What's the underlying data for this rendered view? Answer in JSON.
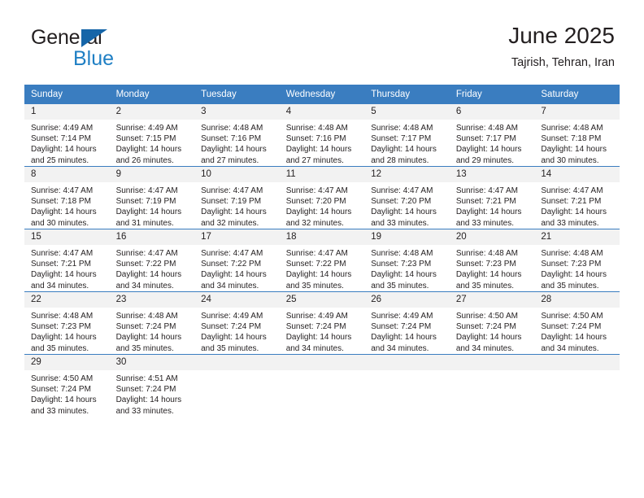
{
  "brand": {
    "name_top": "General",
    "name_bottom": "Blue",
    "accent_color": "#1f7fc4",
    "triangle_color": "#1565a8"
  },
  "header": {
    "title": "June 2025",
    "subtitle": "Tajrish, Tehran, Iran"
  },
  "calendar": {
    "header_bg": "#3a7dc0",
    "daynum_bg": "#f2f2f2",
    "weekdays": [
      "Sunday",
      "Monday",
      "Tuesday",
      "Wednesday",
      "Thursday",
      "Friday",
      "Saturday"
    ],
    "weeks": [
      [
        {
          "day": "1",
          "sunrise": "Sunrise: 4:49 AM",
          "sunset": "Sunset: 7:14 PM",
          "daylight1": "Daylight: 14 hours",
          "daylight2": "and 25 minutes."
        },
        {
          "day": "2",
          "sunrise": "Sunrise: 4:49 AM",
          "sunset": "Sunset: 7:15 PM",
          "daylight1": "Daylight: 14 hours",
          "daylight2": "and 26 minutes."
        },
        {
          "day": "3",
          "sunrise": "Sunrise: 4:48 AM",
          "sunset": "Sunset: 7:16 PM",
          "daylight1": "Daylight: 14 hours",
          "daylight2": "and 27 minutes."
        },
        {
          "day": "4",
          "sunrise": "Sunrise: 4:48 AM",
          "sunset": "Sunset: 7:16 PM",
          "daylight1": "Daylight: 14 hours",
          "daylight2": "and 27 minutes."
        },
        {
          "day": "5",
          "sunrise": "Sunrise: 4:48 AM",
          "sunset": "Sunset: 7:17 PM",
          "daylight1": "Daylight: 14 hours",
          "daylight2": "and 28 minutes."
        },
        {
          "day": "6",
          "sunrise": "Sunrise: 4:48 AM",
          "sunset": "Sunset: 7:17 PM",
          "daylight1": "Daylight: 14 hours",
          "daylight2": "and 29 minutes."
        },
        {
          "day": "7",
          "sunrise": "Sunrise: 4:48 AM",
          "sunset": "Sunset: 7:18 PM",
          "daylight1": "Daylight: 14 hours",
          "daylight2": "and 30 minutes."
        }
      ],
      [
        {
          "day": "8",
          "sunrise": "Sunrise: 4:47 AM",
          "sunset": "Sunset: 7:18 PM",
          "daylight1": "Daylight: 14 hours",
          "daylight2": "and 30 minutes."
        },
        {
          "day": "9",
          "sunrise": "Sunrise: 4:47 AM",
          "sunset": "Sunset: 7:19 PM",
          "daylight1": "Daylight: 14 hours",
          "daylight2": "and 31 minutes."
        },
        {
          "day": "10",
          "sunrise": "Sunrise: 4:47 AM",
          "sunset": "Sunset: 7:19 PM",
          "daylight1": "Daylight: 14 hours",
          "daylight2": "and 32 minutes."
        },
        {
          "day": "11",
          "sunrise": "Sunrise: 4:47 AM",
          "sunset": "Sunset: 7:20 PM",
          "daylight1": "Daylight: 14 hours",
          "daylight2": "and 32 minutes."
        },
        {
          "day": "12",
          "sunrise": "Sunrise: 4:47 AM",
          "sunset": "Sunset: 7:20 PM",
          "daylight1": "Daylight: 14 hours",
          "daylight2": "and 33 minutes."
        },
        {
          "day": "13",
          "sunrise": "Sunrise: 4:47 AM",
          "sunset": "Sunset: 7:21 PM",
          "daylight1": "Daylight: 14 hours",
          "daylight2": "and 33 minutes."
        },
        {
          "day": "14",
          "sunrise": "Sunrise: 4:47 AM",
          "sunset": "Sunset: 7:21 PM",
          "daylight1": "Daylight: 14 hours",
          "daylight2": "and 33 minutes."
        }
      ],
      [
        {
          "day": "15",
          "sunrise": "Sunrise: 4:47 AM",
          "sunset": "Sunset: 7:21 PM",
          "daylight1": "Daylight: 14 hours",
          "daylight2": "and 34 minutes."
        },
        {
          "day": "16",
          "sunrise": "Sunrise: 4:47 AM",
          "sunset": "Sunset: 7:22 PM",
          "daylight1": "Daylight: 14 hours",
          "daylight2": "and 34 minutes."
        },
        {
          "day": "17",
          "sunrise": "Sunrise: 4:47 AM",
          "sunset": "Sunset: 7:22 PM",
          "daylight1": "Daylight: 14 hours",
          "daylight2": "and 34 minutes."
        },
        {
          "day": "18",
          "sunrise": "Sunrise: 4:47 AM",
          "sunset": "Sunset: 7:22 PM",
          "daylight1": "Daylight: 14 hours",
          "daylight2": "and 35 minutes."
        },
        {
          "day": "19",
          "sunrise": "Sunrise: 4:48 AM",
          "sunset": "Sunset: 7:23 PM",
          "daylight1": "Daylight: 14 hours",
          "daylight2": "and 35 minutes."
        },
        {
          "day": "20",
          "sunrise": "Sunrise: 4:48 AM",
          "sunset": "Sunset: 7:23 PM",
          "daylight1": "Daylight: 14 hours",
          "daylight2": "and 35 minutes."
        },
        {
          "day": "21",
          "sunrise": "Sunrise: 4:48 AM",
          "sunset": "Sunset: 7:23 PM",
          "daylight1": "Daylight: 14 hours",
          "daylight2": "and 35 minutes."
        }
      ],
      [
        {
          "day": "22",
          "sunrise": "Sunrise: 4:48 AM",
          "sunset": "Sunset: 7:23 PM",
          "daylight1": "Daylight: 14 hours",
          "daylight2": "and 35 minutes."
        },
        {
          "day": "23",
          "sunrise": "Sunrise: 4:48 AM",
          "sunset": "Sunset: 7:24 PM",
          "daylight1": "Daylight: 14 hours",
          "daylight2": "and 35 minutes."
        },
        {
          "day": "24",
          "sunrise": "Sunrise: 4:49 AM",
          "sunset": "Sunset: 7:24 PM",
          "daylight1": "Daylight: 14 hours",
          "daylight2": "and 35 minutes."
        },
        {
          "day": "25",
          "sunrise": "Sunrise: 4:49 AM",
          "sunset": "Sunset: 7:24 PM",
          "daylight1": "Daylight: 14 hours",
          "daylight2": "and 34 minutes."
        },
        {
          "day": "26",
          "sunrise": "Sunrise: 4:49 AM",
          "sunset": "Sunset: 7:24 PM",
          "daylight1": "Daylight: 14 hours",
          "daylight2": "and 34 minutes."
        },
        {
          "day": "27",
          "sunrise": "Sunrise: 4:50 AM",
          "sunset": "Sunset: 7:24 PM",
          "daylight1": "Daylight: 14 hours",
          "daylight2": "and 34 minutes."
        },
        {
          "day": "28",
          "sunrise": "Sunrise: 4:50 AM",
          "sunset": "Sunset: 7:24 PM",
          "daylight1": "Daylight: 14 hours",
          "daylight2": "and 34 minutes."
        }
      ],
      [
        {
          "day": "29",
          "sunrise": "Sunrise: 4:50 AM",
          "sunset": "Sunset: 7:24 PM",
          "daylight1": "Daylight: 14 hours",
          "daylight2": "and 33 minutes."
        },
        {
          "day": "30",
          "sunrise": "Sunrise: 4:51 AM",
          "sunset": "Sunset: 7:24 PM",
          "daylight1": "Daylight: 14 hours",
          "daylight2": "and 33 minutes."
        },
        {
          "day": "",
          "sunrise": "",
          "sunset": "",
          "daylight1": "",
          "daylight2": ""
        },
        {
          "day": "",
          "sunrise": "",
          "sunset": "",
          "daylight1": "",
          "daylight2": ""
        },
        {
          "day": "",
          "sunrise": "",
          "sunset": "",
          "daylight1": "",
          "daylight2": ""
        },
        {
          "day": "",
          "sunrise": "",
          "sunset": "",
          "daylight1": "",
          "daylight2": ""
        },
        {
          "day": "",
          "sunrise": "",
          "sunset": "",
          "daylight1": "",
          "daylight2": ""
        }
      ]
    ]
  }
}
